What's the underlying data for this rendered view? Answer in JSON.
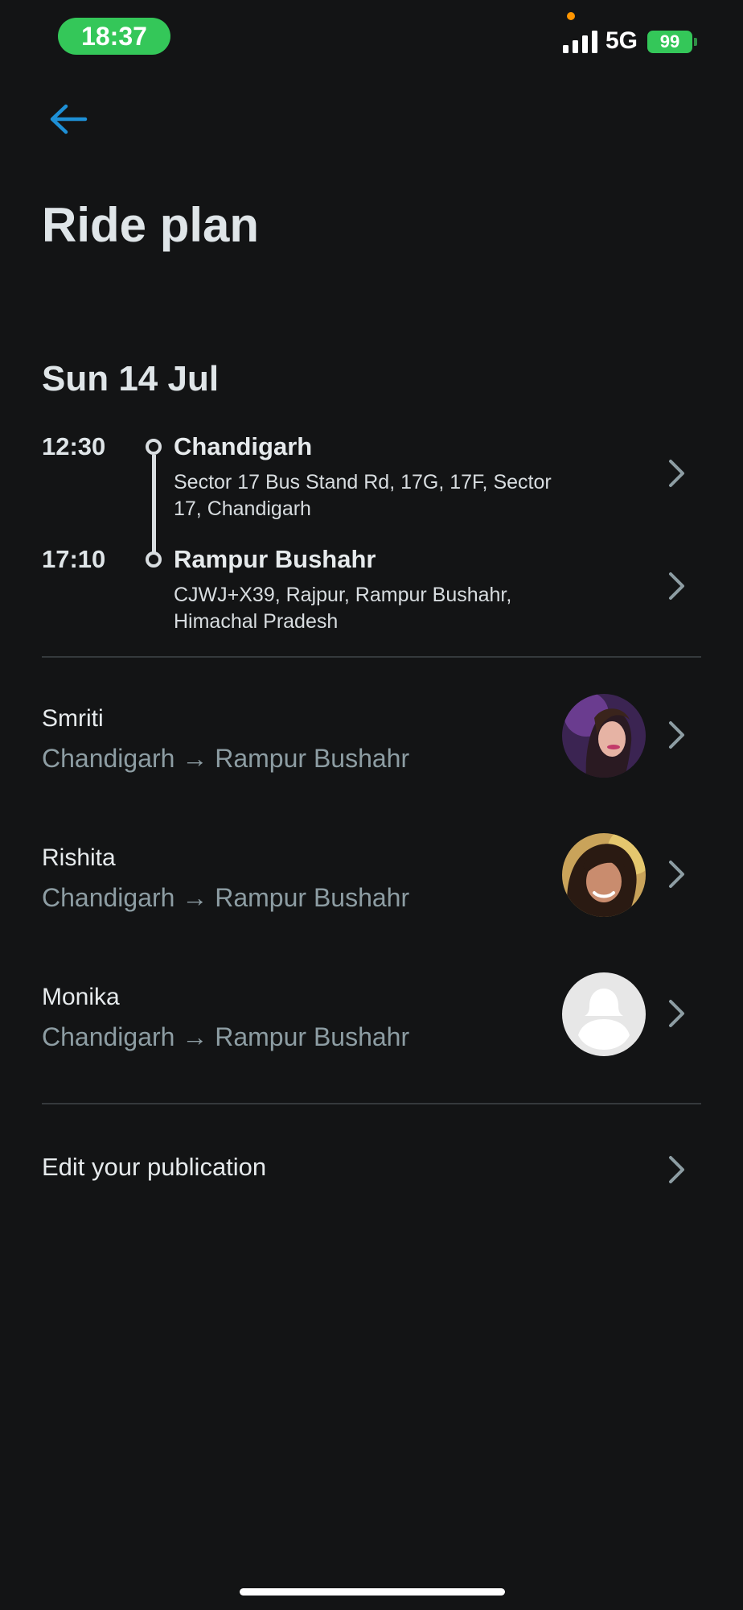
{
  "status_bar": {
    "time": "18:37",
    "network": "5G",
    "battery": "99"
  },
  "header": {
    "back_icon": "arrow-left-icon",
    "title": "Ride plan"
  },
  "ride": {
    "date": "Sun 14 Jul",
    "stops": [
      {
        "time": "12:30",
        "city": "Chandigarh",
        "address": "Sector 17 Bus Stand Rd, 17G, 17F, Sector 17, Chandigarh"
      },
      {
        "time": "17:10",
        "city": "Rampur Bushahr",
        "address": "CJWJ+X39, Rajpur, Rampur Bushahr, Himachal Pradesh"
      }
    ]
  },
  "passengers": [
    {
      "name": "Smriti",
      "route": "Chandigarh → Rampur Bushahr"
    },
    {
      "name": "Rishita",
      "route": "Chandigarh → Rampur Bushahr"
    },
    {
      "name": "Monika",
      "route": "Chandigarh → Rampur Bushahr"
    }
  ],
  "actions": {
    "edit_publication": "Edit your publication"
  },
  "colors": {
    "background": "#131415",
    "accent": "#1e90d6",
    "status_green": "#34c759",
    "muted_text": "#8d9da3"
  }
}
